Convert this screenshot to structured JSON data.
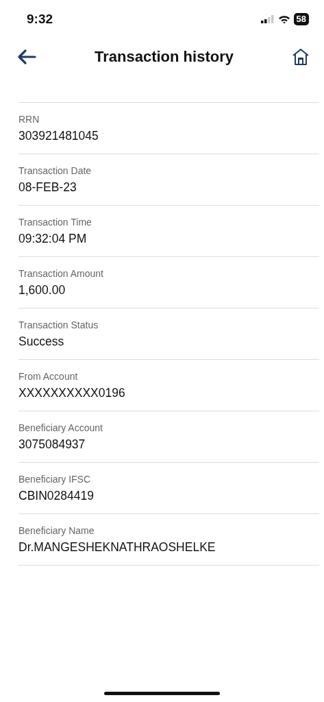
{
  "status_bar": {
    "time": "9:32",
    "battery": "58"
  },
  "header": {
    "title": "Transaction history"
  },
  "details": [
    {
      "label": "RRN",
      "value": "303921481045"
    },
    {
      "label": "Transaction Date",
      "value": "08-FEB-23"
    },
    {
      "label": "Transaction Time",
      "value": "09:32:04 PM"
    },
    {
      "label": "Transaction Amount",
      "value": "1,600.00"
    },
    {
      "label": "Transaction Status",
      "value": "Success"
    },
    {
      "label": "From Account",
      "value": "XXXXXXXXXX0196"
    },
    {
      "label": "Beneficiary Account",
      "value": "3075084937"
    },
    {
      "label": "Beneficiary IFSC",
      "value": "CBIN0284419"
    },
    {
      "label": "Beneficiary Name",
      "value": "Dr.MANGESHEKNATHRAOSHELKE"
    }
  ]
}
